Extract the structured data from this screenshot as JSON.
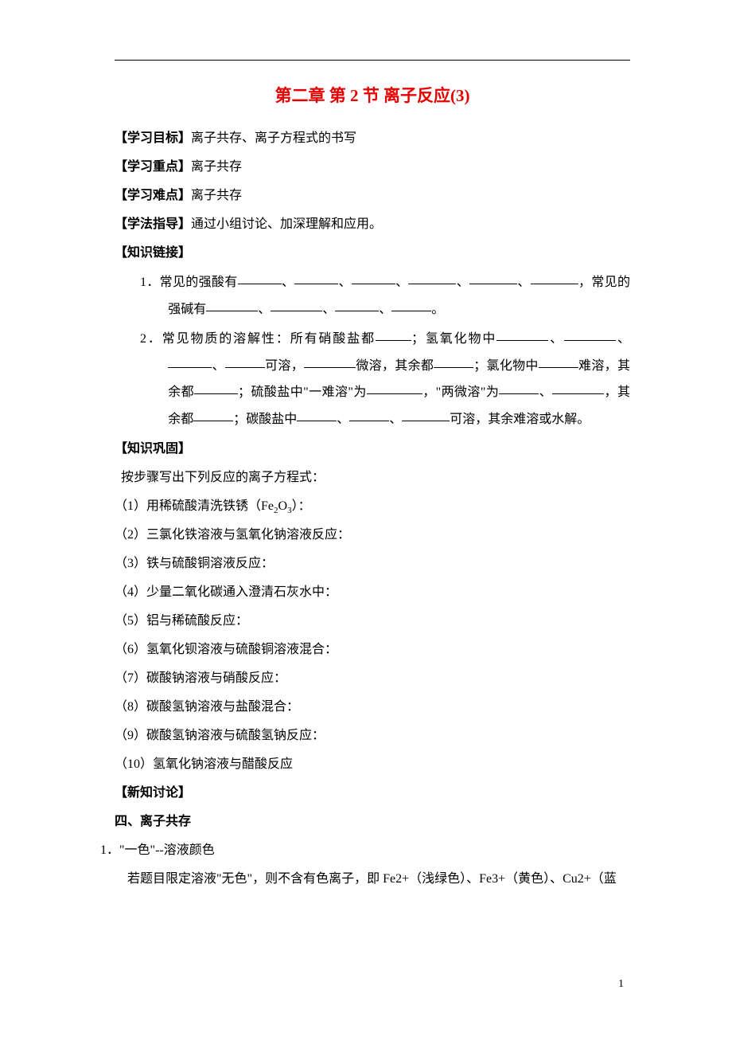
{
  "title": "第二章 第 2 节 离子反应(3)",
  "sections": {
    "goal_label": "【学习目标】",
    "goal_text": "离子共存、离子方程式的书写",
    "focus_label": "【学习重点】",
    "focus_text": "离子共存",
    "difficulty_label": "【学习难点】",
    "difficulty_text": "离子共存",
    "method_label": "【学法指导】",
    "method_text": "通过小组讨论、加深理解和应用。",
    "knowledge_link_label": "【知识链接】",
    "consolidation_label": "【知识巩固】",
    "consolidation_intro": "按步骤写出下列反应的离子方程式：",
    "new_discussion_label": "【新知讨论】",
    "section_four_label": "四、离子共存",
    "color_rule_num": "1．",
    "color_rule_head": "\"一色\"--溶液颜色",
    "color_rule_body": "若题目限定溶液\"无色\"，则不含有色离子，即 Fe2+（浅绿色）、Fe3+（黄色）、Cu2+（蓝"
  },
  "knowledge_link_items": {
    "item1_num": "1．",
    "item1_pre": "常见的强酸有",
    "item1_mid": "，常见的强碱有",
    "item2_num": "2．",
    "item2_a": "常见物质的溶解性：所有硝酸盐都",
    "item2_b": "；氢氧化物中",
    "item2_c": "可溶，",
    "item2_d": "微溶，其余都",
    "item2_e": "；氯化物中",
    "item2_f": "难溶，其余都",
    "item2_g": "；硫酸盐中\"一难溶\"为",
    "item2_h": "，\"两微溶\"为",
    "item2_i": "，其余都",
    "item2_j": "；碳酸盐中",
    "item2_k": "可溶，其余难溶或水解。"
  },
  "consolidation_items": [
    "（1）用稀硫酸清洗铁锈（Fe₂O₃）：",
    "（2）三氯化铁溶液与氢氧化钠溶液反应：",
    "（3）铁与硫酸铜溶液反应：",
    "（4）少量二氧化碳通入澄清石灰水中：",
    "（5）铝与稀硫酸反应：",
    "（6）氢氧化钡溶液与硫酸铜溶液混合：",
    "（7）碳酸钠溶液与硝酸反应：",
    "（8）碳酸氢钠溶液与盐酸混合：",
    "（9）碳酸氢钠溶液与硫酸氢钠反应：",
    "（10）氢氧化钠溶液与醋酸反应"
  ],
  "footer_page": "1"
}
